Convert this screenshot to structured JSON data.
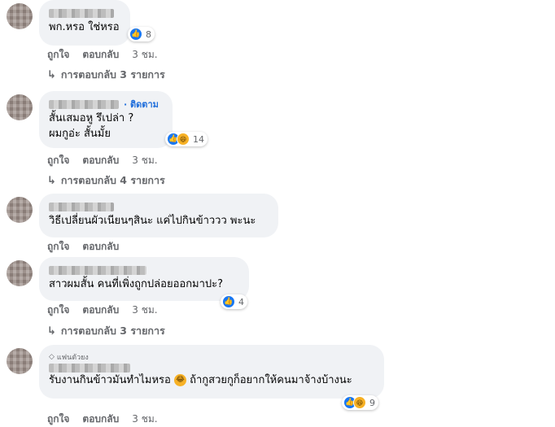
{
  "comments": [
    {
      "text_lines": [
        "พก.หรอ ใช่หรอ"
      ],
      "reactions": {
        "count": "8",
        "types": [
          "like-icon"
        ]
      },
      "actions": {
        "like": "ถูกใจ",
        "reply": "ตอบกลับ",
        "time": "3 ชม."
      },
      "replies_label": "การตอบกลับ 3 รายการ"
    },
    {
      "follow_label": "ติดตาม",
      "text_lines": [
        "สั้นเสมอหู รึเปล่า ?",
        "ผมกูอ่ะ สั้นมั้ย"
      ],
      "reactions": {
        "count": "14",
        "types": [
          "like-icon",
          "haha-icon"
        ]
      },
      "actions": {
        "like": "ถูกใจ",
        "reply": "ตอบกลับ",
        "time": "3 ชม."
      },
      "replies_label": "การตอบกลับ 4 รายการ"
    },
    {
      "text_lines": [
        "วิธีเปลี่ยนผัวเนียนๆสินะ แค่ไปกินข้าววว พะนะ"
      ],
      "actions": {
        "like": "ถูกใจ",
        "reply": "ตอบกลับ"
      }
    },
    {
      "text_lines": [
        "สาวผมสั้น คนที่เพิ่งถูกปล่อยออกมาปะ?"
      ],
      "reactions": {
        "count": "4",
        "types": [
          "like-icon"
        ]
      },
      "actions": {
        "like": "ถูกใจ",
        "reply": "ตอบกลับ",
        "time": "3 ชม."
      },
      "replies_label": "การตอบกลับ 3 รายการ"
    },
    {
      "badge_label": "แฟนตัวยง",
      "text_before_emoji": "รับงานกินข้าวมันทำไมหรอ",
      "text_after_emoji": "ถ้ากูสวยกูก็อยากให้คนมาจ้างบ้างนะ",
      "reactions": {
        "count": "9",
        "types": [
          "like-icon",
          "haha-icon"
        ]
      },
      "actions": {
        "like": "ถูกใจ",
        "reply": "ตอบกลับ",
        "time": "3 ชม."
      }
    }
  ],
  "colors": {
    "bubble": "#f0f2f5",
    "meta": "#65676b",
    "link": "#216fdb",
    "like": "#1877f2"
  }
}
